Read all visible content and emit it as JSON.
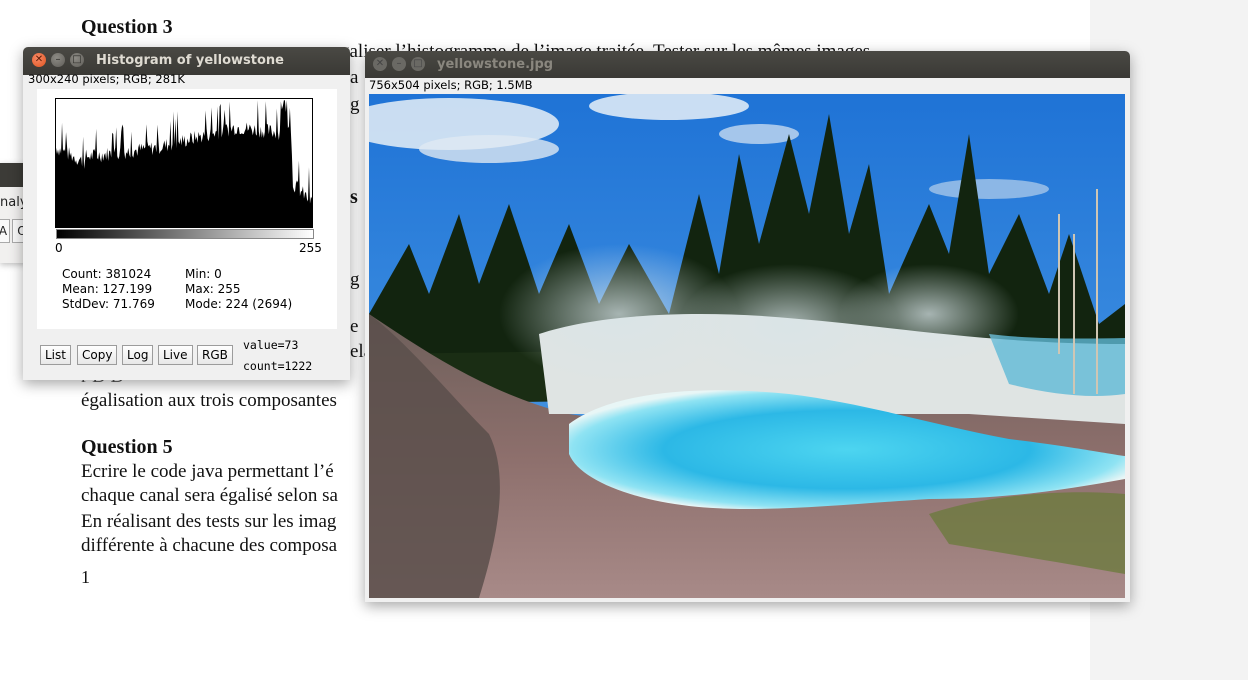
{
  "document": {
    "question3_heading": "Question 3",
    "q3_line1": "galiser l’histogramme de l’image traitée. Tester sur les mêmes images",
    "frag_a": "a",
    "frag_g1": "g",
    "frag_s": "s",
    "frag_g2": "g",
    "frag_e": "e",
    "frag_ela": "ela",
    "line_partial": "r   D       D",
    "line_egal": "égalisation aux trois composantes",
    "question5_heading": "Question 5",
    "q5_line1": "Ecrire le code java permettant l’é",
    "q5_line2": "chaque canal sera égalisé selon sa",
    "q5_line3": "En réalisant des tests sur les imag",
    "q5_line4": "différente à chacune des composa",
    "page_number": "1"
  },
  "partial_window": {
    "label": "nalyz",
    "button_a": "A",
    "button_b": "O"
  },
  "histogram_window": {
    "title": "Histogram of yellowstone",
    "info": "300x240 pixels; RGB; 281K",
    "axis_min_label": "0",
    "axis_max_label": "255",
    "stats": {
      "count": "Count: 381024",
      "mean": "Mean: 127.199",
      "stddev": "StdDev: 71.769",
      "min": "Min: 0",
      "max": "Max: 255",
      "mode": "Mode: 224 (2694)"
    },
    "buttons": [
      "List",
      "Copy",
      "Log",
      "Live",
      "RGB"
    ],
    "value_readout": "value=73",
    "count_readout": "count=1222",
    "colors": {
      "titlebar": "#3c3b37",
      "close": "#e95420"
    }
  },
  "image_window": {
    "title": "yellowstone.jpg",
    "info": "756x504 pixels; RGB; 1.5MB",
    "image_alt": "yellowstone"
  }
}
